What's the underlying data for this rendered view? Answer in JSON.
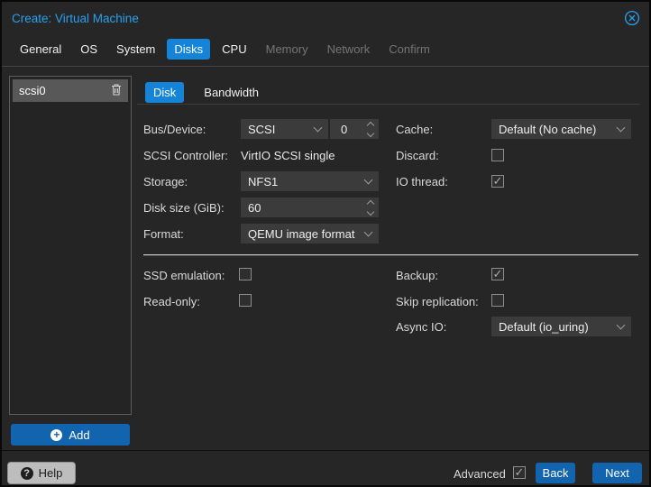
{
  "colors": {
    "accent_blue": "#1583d7",
    "button_blue": "#1264ae",
    "title_blue": "#28a0f0",
    "dialog_bg": "#262626",
    "field_bg": "#3b3b3b",
    "selected_row_bg": "#585858",
    "disabled_tab_text": "#757575",
    "help_button_bg": "#bdbdbd"
  },
  "window": {
    "title": "Create: Virtual Machine",
    "close_icon": "circle-x"
  },
  "tabs": [
    {
      "label": "General",
      "state": "normal"
    },
    {
      "label": "OS",
      "state": "normal"
    },
    {
      "label": "System",
      "state": "normal"
    },
    {
      "label": "Disks",
      "state": "active"
    },
    {
      "label": "CPU",
      "state": "normal"
    },
    {
      "label": "Memory",
      "state": "disabled"
    },
    {
      "label": "Network",
      "state": "disabled"
    },
    {
      "label": "Confirm",
      "state": "disabled"
    }
  ],
  "disk_panel": {
    "items": [
      {
        "label": "scsi0",
        "selected": true,
        "delete_icon": "trash"
      }
    ],
    "add_label": "Add",
    "add_icon": "plus-circle"
  },
  "subtabs": [
    {
      "label": "Disk",
      "active": true
    },
    {
      "label": "Bandwidth",
      "active": false
    }
  ],
  "form": {
    "bus_device": {
      "label": "Bus/Device:",
      "bus": "SCSI",
      "device": "0"
    },
    "scsi_controller": {
      "label": "SCSI Controller:",
      "value": "VirtIO SCSI single"
    },
    "storage": {
      "label": "Storage:",
      "value": "NFS1"
    },
    "disk_size": {
      "label": "Disk size (GiB):",
      "value": "60"
    },
    "format": {
      "label": "Format:",
      "value": "QEMU image format"
    },
    "cache": {
      "label": "Cache:",
      "value": "Default (No cache)"
    },
    "discard": {
      "label": "Discard:",
      "checked": false
    },
    "io_thread": {
      "label": "IO thread:",
      "checked": true
    },
    "ssd_emulation": {
      "label": "SSD emulation:",
      "checked": false
    },
    "read_only": {
      "label": "Read-only:",
      "checked": false
    },
    "backup": {
      "label": "Backup:",
      "checked": true
    },
    "skip_replication": {
      "label": "Skip replication:",
      "checked": false
    },
    "async_io": {
      "label": "Async IO:",
      "value": "Default (io_uring)"
    }
  },
  "footer": {
    "help_label": "Help",
    "help_icon": "question-circle",
    "advanced_label": "Advanced",
    "advanced_checked": true,
    "back_label": "Back",
    "next_label": "Next"
  }
}
